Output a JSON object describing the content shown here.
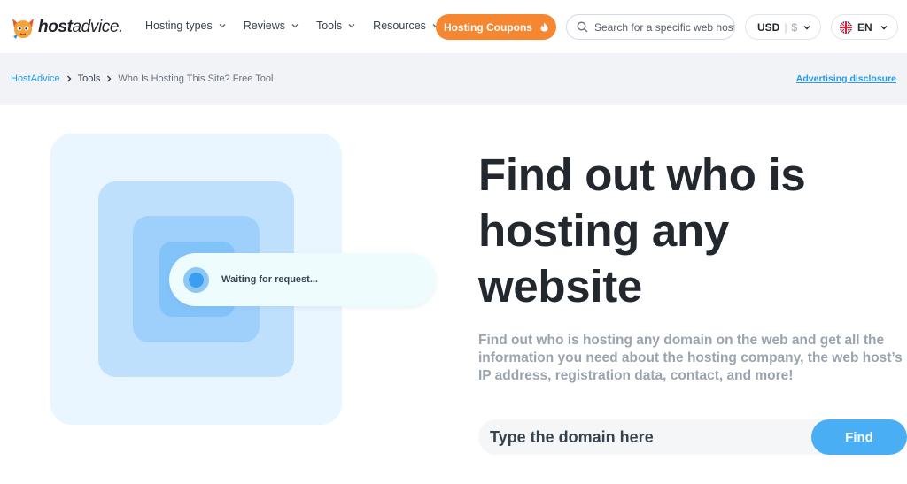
{
  "brand": {
    "name_bold": "host",
    "name_rest": "advice."
  },
  "nav": {
    "items": [
      {
        "label": "Hosting types"
      },
      {
        "label": "Reviews"
      },
      {
        "label": "Tools"
      },
      {
        "label": "Resources"
      }
    ],
    "coupons_label": "Hosting Coupons",
    "search_placeholder": "Search for a specific web host",
    "currency_code": "USD",
    "currency_symbol": "$",
    "language": "EN"
  },
  "breadcrumb": {
    "home": "HostAdvice",
    "section": "Tools",
    "current": "Who Is Hosting This Site? Free Tool",
    "disclosure": "Advertising disclosure"
  },
  "illustration": {
    "status": "Waiting for request..."
  },
  "hero": {
    "title": "Find out who is hosting any website",
    "subtitle": "Find out who is hosting any domain on the web and get all the information you need about the hosting company, the web host’s IP address, registration data, contact, and more!",
    "domain_placeholder": "Type the domain here",
    "find_label": "Find"
  },
  "colors": {
    "accent_orange": "#f78631",
    "accent_blue": "#4aaef4",
    "link_blue": "#2a9ae6"
  }
}
